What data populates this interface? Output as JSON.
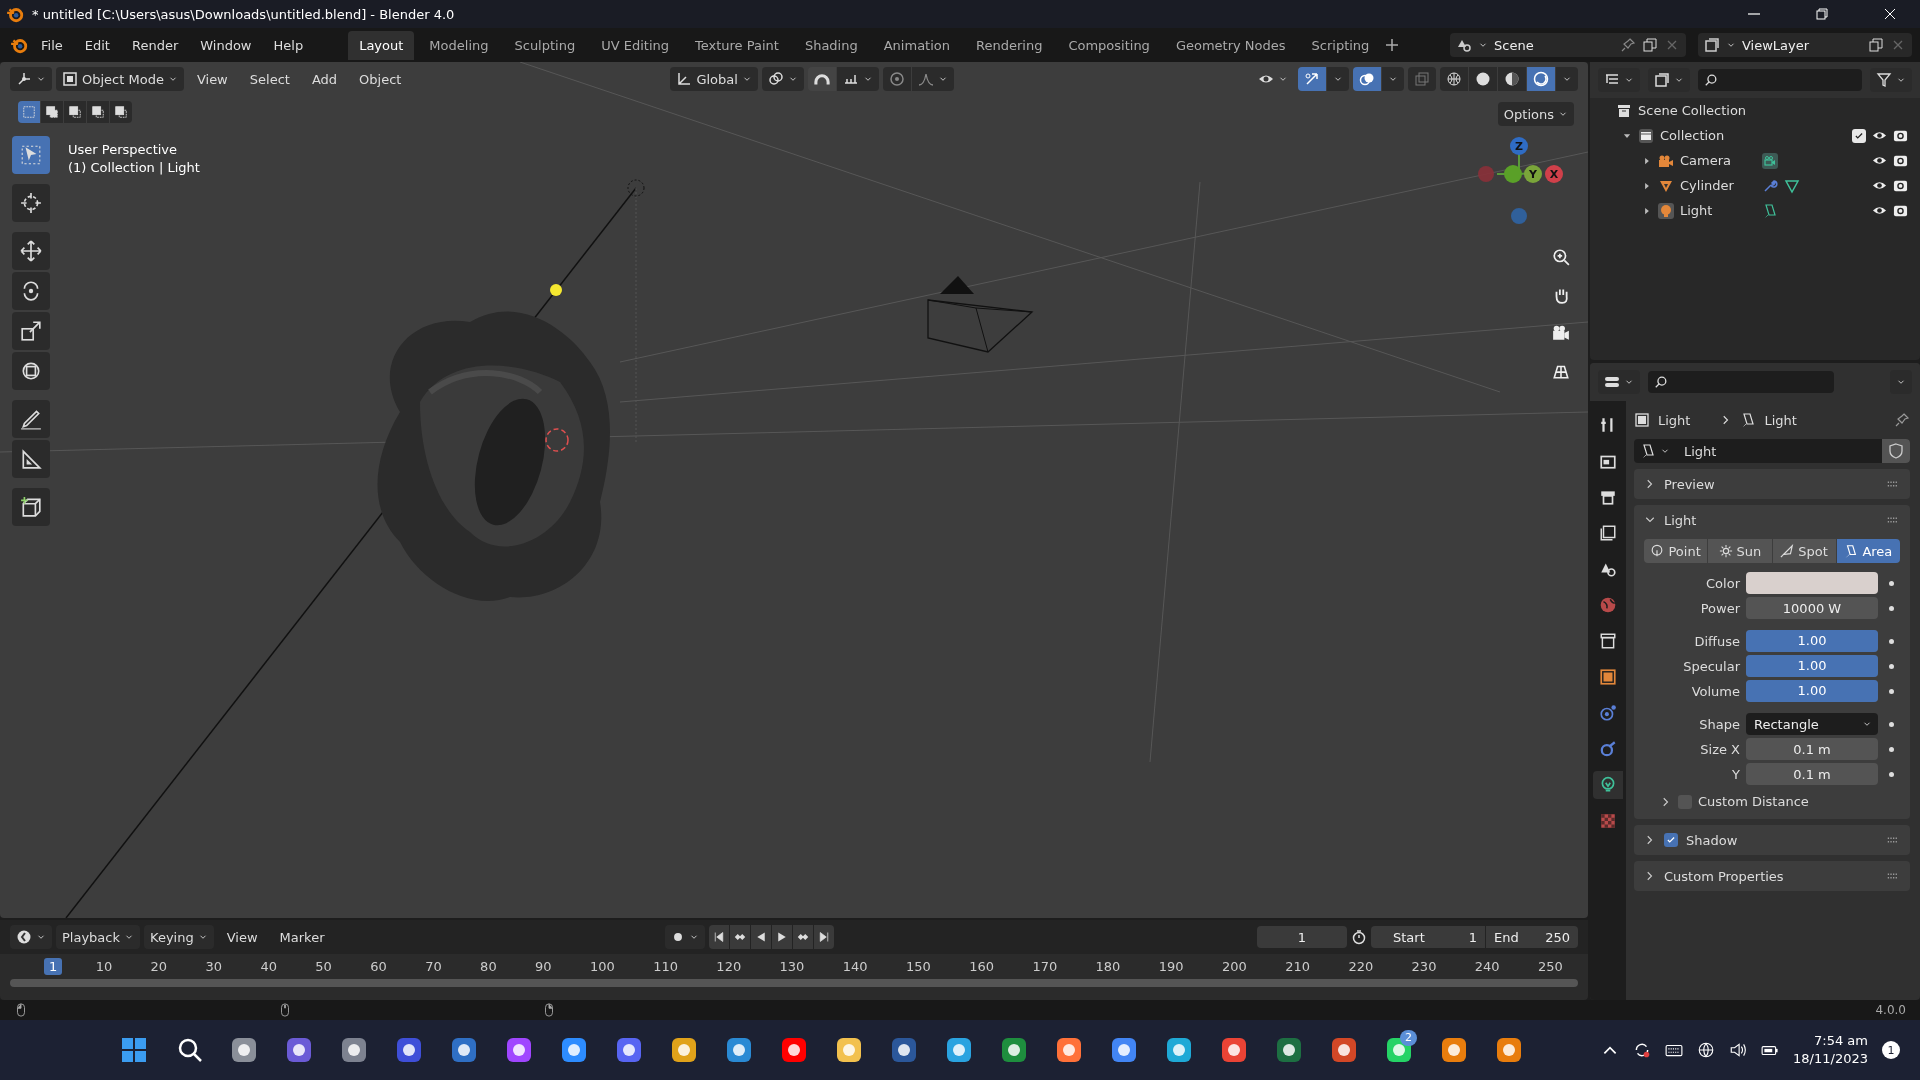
{
  "window": {
    "title": "* untitled [C:\\Users\\asus\\Downloads\\untitled.blend] - Blender 4.0"
  },
  "menu": [
    "File",
    "Edit",
    "Render",
    "Window",
    "Help"
  ],
  "workspaces": [
    {
      "label": "Layout",
      "selected": true
    },
    {
      "label": "Modeling",
      "selected": false
    },
    {
      "label": "Sculpting",
      "selected": false
    },
    {
      "label": "UV Editing",
      "selected": false
    },
    {
      "label": "Texture Paint",
      "selected": false
    },
    {
      "label": "Shading",
      "selected": false
    },
    {
      "label": "Animation",
      "selected": false
    },
    {
      "label": "Rendering",
      "selected": false
    },
    {
      "label": "Compositing",
      "selected": false
    },
    {
      "label": "Geometry Nodes",
      "selected": false
    },
    {
      "label": "Scripting",
      "selected": false
    }
  ],
  "scene": {
    "name": "Scene"
  },
  "view_layer": {
    "name": "ViewLayer"
  },
  "viewport": {
    "mode": "Object Mode",
    "menus": [
      "View",
      "Select",
      "Add",
      "Object"
    ],
    "orientation": "Global",
    "options": "Options",
    "select_modes": [
      {
        "selected": true
      },
      {
        "selected": false
      },
      {
        "selected": false
      },
      {
        "selected": false
      },
      {
        "selected": false
      }
    ],
    "shading": [
      {
        "selected": false
      },
      {
        "selected": false
      },
      {
        "selected": false
      },
      {
        "selected": true
      }
    ],
    "info": [
      "User Perspective",
      "(1) Collection | Light"
    ],
    "tools": [
      {
        "selected": true
      },
      {
        "selected": false
      },
      {
        "selected": false
      },
      {
        "selected": false
      },
      {
        "selected": false
      },
      {
        "selected": false
      },
      {
        "selected": false
      },
      {
        "selected": false
      },
      {
        "selected": false
      }
    ],
    "gizmo": {
      "z": "Z",
      "y": "Y",
      "x": "X"
    }
  },
  "outliner": {
    "root": "Scene Collection",
    "items": [
      {
        "name": "Collection",
        "kind": "collection",
        "expanded": true,
        "checked": true,
        "children": [
          {
            "name": "Camera",
            "kind": "camera",
            "expanded": false
          },
          {
            "name": "Cylinder",
            "kind": "mesh",
            "expanded": false
          },
          {
            "name": "Light",
            "kind": "light",
            "expanded": false
          }
        ]
      }
    ]
  },
  "properties": {
    "tabs": [
      {
        "selected": false
      },
      {
        "selected": false
      },
      {
        "selected": false
      },
      {
        "selected": false
      },
      {
        "selected": false
      },
      {
        "selected": false
      },
      {
        "selected": false
      },
      {
        "selected": false
      },
      {
        "selected": false
      },
      {
        "selected": false
      },
      {
        "selected": true
      },
      {
        "selected": false
      }
    ],
    "breadcrumb": [
      "Light",
      "Light"
    ],
    "datablock": "Light",
    "panels": [
      {
        "title": "Preview",
        "expanded": false
      },
      {
        "title": "Light",
        "expanded": true,
        "types": [
          {
            "label": "Point",
            "selected": false
          },
          {
            "label": "Sun",
            "selected": false
          },
          {
            "label": "Spot",
            "selected": false
          },
          {
            "label": "Area",
            "selected": true
          }
        ],
        "fields": [
          {
            "label": "Color",
            "kind": "color",
            "color": "#d9d0cd"
          },
          {
            "label": "Power",
            "kind": "number",
            "value": "10000 W"
          },
          {
            "label": "Diffuse",
            "kind": "slider",
            "value": "1.00",
            "level": 1
          },
          {
            "label": "Specular",
            "kind": "slider",
            "value": "1.00",
            "level": 1
          },
          {
            "label": "Volume",
            "kind": "slider",
            "value": "1.00",
            "level": 1
          },
          {
            "label": "Shape",
            "kind": "dropdown",
            "value": "Rectangle"
          },
          {
            "label": "Size X",
            "kind": "number",
            "value": "0.1 m"
          },
          {
            "label": "Y",
            "kind": "number",
            "value": "0.1 m"
          }
        ],
        "custom_distance": {
          "label": "Custom Distance",
          "checked": false,
          "expanded": false
        }
      },
      {
        "title": "Shadow",
        "expanded": false,
        "checked": true
      },
      {
        "title": "Custom Properties",
        "expanded": false
      }
    ]
  },
  "timeline": {
    "menus": [
      "Playback",
      "Keying",
      "View",
      "Marker"
    ],
    "current_frame": "1",
    "start": {
      "label": "Start",
      "value": "1"
    },
    "end": {
      "label": "End",
      "value": "250"
    },
    "ruler": [
      {
        "label": "1",
        "selected": true
      },
      {
        "label": "10",
        "selected": false
      },
      {
        "label": "20",
        "selected": false
      },
      {
        "label": "30",
        "selected": false
      },
      {
        "label": "40",
        "selected": false
      },
      {
        "label": "50",
        "selected": false
      },
      {
        "label": "60",
        "selected": false
      },
      {
        "label": "70",
        "selected": false
      },
      {
        "label": "80",
        "selected": false
      },
      {
        "label": "90",
        "selected": false
      },
      {
        "label": "100",
        "selected": false
      },
      {
        "label": "110",
        "selected": false
      },
      {
        "label": "120",
        "selected": false
      },
      {
        "label": "130",
        "selected": false
      },
      {
        "label": "140",
        "selected": false
      },
      {
        "label": "150",
        "selected": false
      },
      {
        "label": "160",
        "selected": false
      },
      {
        "label": "170",
        "selected": false
      },
      {
        "label": "180",
        "selected": false
      },
      {
        "label": "190",
        "selected": false
      },
      {
        "label": "200",
        "selected": false
      },
      {
        "label": "210",
        "selected": false
      },
      {
        "label": "220",
        "selected": false
      },
      {
        "label": "230",
        "selected": false
      },
      {
        "label": "240",
        "selected": false
      },
      {
        "label": "250",
        "selected": false
      }
    ]
  },
  "status": {
    "version": "4.0.0"
  },
  "taskbar": {
    "apps": [
      {
        "kind": "windows",
        "color": "#3b9cf0"
      },
      {
        "kind": "search",
        "color": "#ffffff"
      },
      {
        "kind": "app",
        "color": "#8a8f99"
      },
      {
        "kind": "app",
        "color": "#6b5bd6"
      },
      {
        "kind": "app",
        "color": "#7d8290"
      },
      {
        "kind": "app",
        "color": "#3f4fd8"
      },
      {
        "kind": "app",
        "color": "#2f6fc4"
      },
      {
        "kind": "app",
        "color": "#a046ff"
      },
      {
        "kind": "app",
        "color": "#2d8cff"
      },
      {
        "kind": "app",
        "color": "#5865f2"
      },
      {
        "kind": "app",
        "color": "#e0a21a"
      },
      {
        "kind": "app",
        "color": "#2a8ad4"
      },
      {
        "kind": "app",
        "color": "#ff0000"
      },
      {
        "kind": "app",
        "color": "#f2c14e"
      },
      {
        "kind": "app",
        "color": "#2b579a"
      },
      {
        "kind": "app",
        "color": "#2aa3e0"
      },
      {
        "kind": "app",
        "color": "#1e8e3e"
      },
      {
        "kind": "app",
        "color": "#ff7139"
      },
      {
        "kind": "app",
        "color": "#4285f4"
      },
      {
        "kind": "app",
        "color": "#1fa9d6"
      },
      {
        "kind": "app",
        "color": "#ea4335"
      },
      {
        "kind": "app",
        "color": "#1d6f42"
      },
      {
        "kind": "app",
        "color": "#d24726"
      },
      {
        "kind": "app",
        "color": "#25d366",
        "badge": "2"
      },
      {
        "kind": "app",
        "color": "#e87d0d"
      },
      {
        "kind": "app",
        "color": "#e87d0d"
      }
    ],
    "time": "7:54 am",
    "date": "18/11/2023",
    "notifications": "1"
  }
}
